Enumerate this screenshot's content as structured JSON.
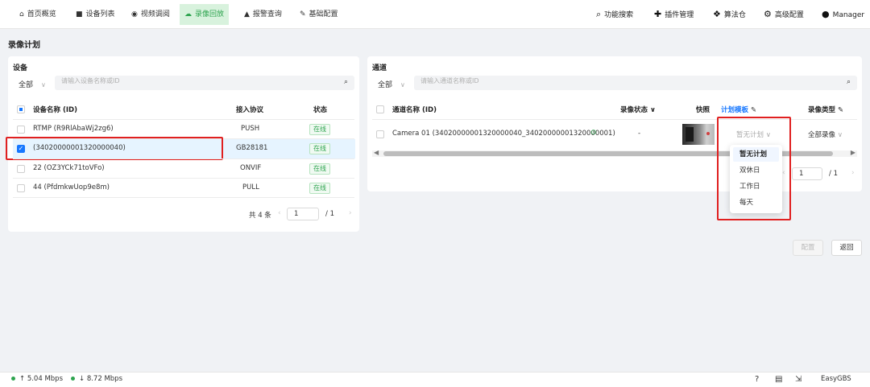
{
  "nav": {
    "left": [
      {
        "label": "首页概览",
        "icon": "home-icon"
      },
      {
        "label": "设备列表",
        "icon": "video-camera-icon"
      },
      {
        "label": "视频调阅",
        "icon": "play-circle-icon"
      },
      {
        "label": "录像回放",
        "icon": "cloud-icon"
      },
      {
        "label": "报警查询",
        "icon": "alarm-icon"
      },
      {
        "label": "基础配置",
        "icon": "edit-icon"
      }
    ],
    "right": [
      {
        "label": "功能搜索",
        "icon": "search-icon"
      },
      {
        "label": "插件管理",
        "icon": "puzzle-icon"
      },
      {
        "label": "算法仓",
        "icon": "dropbox-icon"
      },
      {
        "label": "高级配置",
        "icon": "gear-icon"
      },
      {
        "label": "Manager",
        "icon": "user-icon"
      }
    ]
  },
  "page": {
    "title": "录像计划"
  },
  "device_panel": {
    "title": "设备",
    "filter": "全部",
    "search_placeholder": "请输入设备名称或ID",
    "columns": {
      "name": "设备名称 (ID)",
      "protocol": "接入协议",
      "status": "状态"
    },
    "rows": [
      {
        "name": "RTMP (R9RlAbaWj2zg6)",
        "protocol": "PUSH",
        "status": "在线"
      },
      {
        "name": "(34020000001320000040)",
        "protocol": "GB28181",
        "status": "在线"
      },
      {
        "name": "22 (OZ3YCk71toVFo)",
        "protocol": "ONVIF",
        "status": "在线"
      },
      {
        "name": "44 (PfdmkwUop9e8m)",
        "protocol": "PULL",
        "status": "在线"
      }
    ],
    "pager": {
      "total": "共 4 条",
      "page": "1",
      "of": "/ 1"
    }
  },
  "channel_panel": {
    "title": "通道",
    "filter": "全部",
    "search_placeholder": "请输入通道名称或ID",
    "columns": {
      "name": "通道名称 (ID)",
      "rec_status": "录像状态",
      "snapshot": "快照",
      "plan": "计划模板",
      "rec_type": "录像类型"
    },
    "rows": [
      {
        "name": "Camera 01 (34020000001320000040_34020000001320000001)",
        "rec_status": "-",
        "plan": "暂无计划",
        "rec_type": "全部录像"
      }
    ],
    "pager": {
      "page": "1",
      "of": "/ 1"
    },
    "dropdown": [
      "暂无计划",
      "双休日",
      "工作日",
      "每天"
    ]
  },
  "actions": {
    "config": "配置",
    "back": "返回"
  },
  "statusbar": {
    "up": "↑ 5.04 Mbps",
    "down": "↓ 8.72 Mbps",
    "brand": "EasyGBS"
  },
  "colors": {
    "accent": "#2ea44f",
    "primary": "#1677ff",
    "highlight": "#e02020"
  }
}
